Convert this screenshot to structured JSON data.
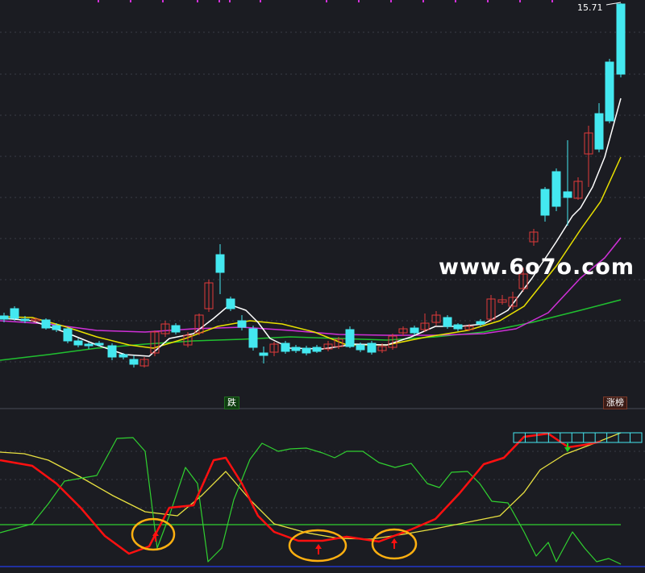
{
  "labels": {
    "last_price": "15.71",
    "watermark": "www.6o7o.com",
    "tag_fall": "跌",
    "tag_limit": "涨榜"
  },
  "colors": {
    "background": "#1b1c22",
    "up_candle": "#e03a3a",
    "down_candle": "#44e8f0",
    "ma_white": "#ffffff",
    "ma_yellow": "#e8e000",
    "ma_magenta": "#d030d8",
    "ma_green": "#20c030",
    "osc_red": "#ff1010",
    "osc_yellow": "#e8e040",
    "osc_green": "#30d030",
    "marker_circle": "#ffb010",
    "grid": "#3a3c45"
  },
  "icons": {
    "signal_up": "red-up-arrow-icon",
    "signal_down": "green-down-arrow-icon"
  }
}
